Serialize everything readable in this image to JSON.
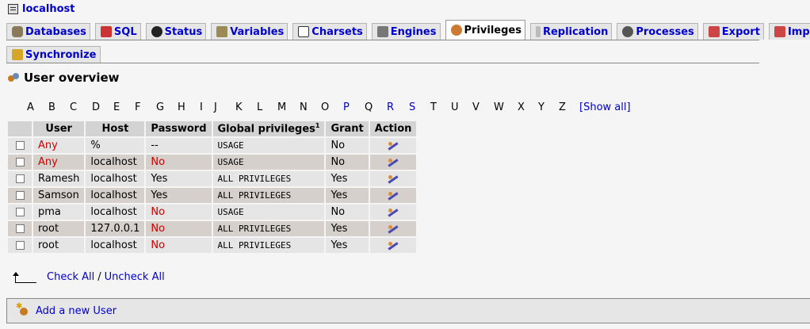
{
  "server": {
    "name": "localhost",
    "icon": "server-icon"
  },
  "tabs": [
    {
      "label": "Databases",
      "icon": "database-icon",
      "active": false
    },
    {
      "label": "SQL",
      "icon": "sql-icon",
      "active": false
    },
    {
      "label": "Status",
      "icon": "status-icon",
      "active": false
    },
    {
      "label": "Variables",
      "icon": "variables-icon",
      "active": false
    },
    {
      "label": "Charsets",
      "icon": "charsets-icon",
      "active": false
    },
    {
      "label": "Engines",
      "icon": "engines-icon",
      "active": false
    },
    {
      "label": "Privileges",
      "icon": "privileges-icon",
      "active": true
    },
    {
      "label": "Replication",
      "icon": "replication-icon",
      "active": false
    },
    {
      "label": "Processes",
      "icon": "processes-icon",
      "active": false
    },
    {
      "label": "Export",
      "icon": "export-icon",
      "active": false
    },
    {
      "label": "Import",
      "icon": "import-icon",
      "active": false
    },
    {
      "label": "Synchronize",
      "icon": "synchronize-icon",
      "active": false
    }
  ],
  "heading": "User overview",
  "letters": [
    {
      "char": "A",
      "link": false
    },
    {
      "char": "B",
      "link": false
    },
    {
      "char": "C",
      "link": false
    },
    {
      "char": "D",
      "link": false
    },
    {
      "char": "E",
      "link": false
    },
    {
      "char": "F",
      "link": false
    },
    {
      "char": "G",
      "link": false
    },
    {
      "char": "H",
      "link": false
    },
    {
      "char": "I",
      "link": false
    },
    {
      "char": "J",
      "link": false
    },
    {
      "char": "K",
      "link": false
    },
    {
      "char": "L",
      "link": false
    },
    {
      "char": "M",
      "link": false
    },
    {
      "char": "N",
      "link": false
    },
    {
      "char": "O",
      "link": false
    },
    {
      "char": "P",
      "link": true
    },
    {
      "char": "Q",
      "link": false
    },
    {
      "char": "R",
      "link": true
    },
    {
      "char": "S",
      "link": true
    },
    {
      "char": "T",
      "link": false
    },
    {
      "char": "U",
      "link": false
    },
    {
      "char": "V",
      "link": false
    },
    {
      "char": "W",
      "link": false
    },
    {
      "char": "X",
      "link": false
    },
    {
      "char": "Y",
      "link": false
    },
    {
      "char": "Z",
      "link": false
    }
  ],
  "show_all": "[Show all]",
  "table": {
    "headers": {
      "user": "User",
      "host": "Host",
      "password": "Password",
      "global_privileges": "Global privileges",
      "footnote": "1",
      "grant": "Grant",
      "action": "Action"
    },
    "rows": [
      {
        "user": "Any",
        "user_red": true,
        "host": "%",
        "password": "--",
        "password_red": false,
        "privileges": "USAGE",
        "grant": "No"
      },
      {
        "user": "Any",
        "user_red": true,
        "host": "localhost",
        "password": "No",
        "password_red": true,
        "privileges": "USAGE",
        "grant": "No"
      },
      {
        "user": "Ramesh",
        "user_red": false,
        "host": "localhost",
        "password": "Yes",
        "password_red": false,
        "privileges": "ALL PRIVILEGES",
        "grant": "Yes"
      },
      {
        "user": "Samson",
        "user_red": false,
        "host": "localhost",
        "password": "Yes",
        "password_red": false,
        "privileges": "ALL PRIVILEGES",
        "grant": "Yes"
      },
      {
        "user": "pma",
        "user_red": false,
        "host": "localhost",
        "password": "No",
        "password_red": true,
        "privileges": "USAGE",
        "grant": "No"
      },
      {
        "user": "root",
        "user_red": false,
        "host": "127.0.0.1",
        "password": "No",
        "password_red": true,
        "privileges": "ALL PRIVILEGES",
        "grant": "Yes"
      },
      {
        "user": "root",
        "user_red": false,
        "host": "localhost",
        "password": "No",
        "password_red": true,
        "privileges": "ALL PRIVILEGES",
        "grant": "Yes"
      }
    ]
  },
  "check_all": "Check All",
  "separator": "/",
  "uncheck_all": "Uncheck All",
  "add_user": "Add a new User",
  "colors": {
    "link": "#0000cc",
    "warning": "#cc0000",
    "header_bg": "#d3d3d3",
    "row_odd": "#e5e5e5",
    "row_even": "#d5d0cb"
  }
}
